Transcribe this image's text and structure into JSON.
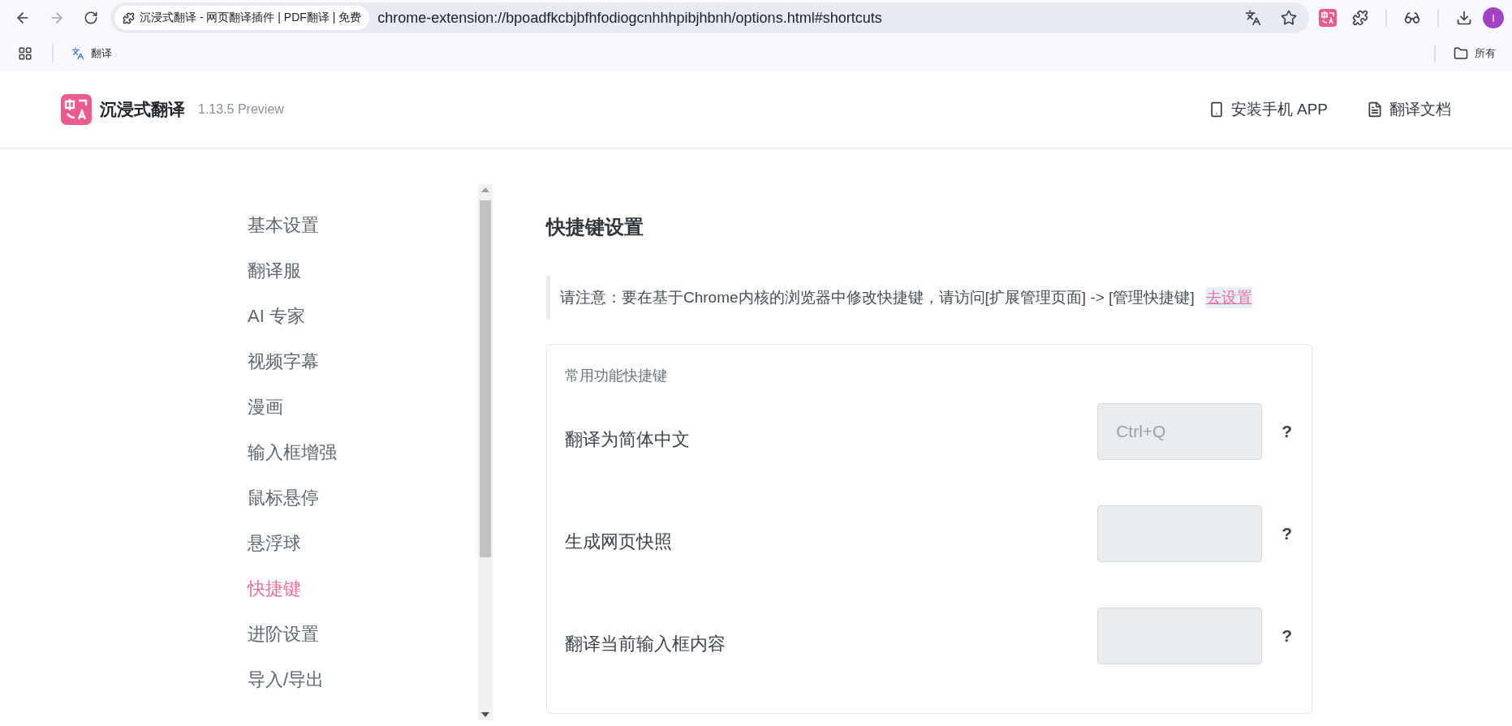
{
  "browser": {
    "tab_title": "沉浸式翻译 - 网页翻译插件 | PDF翻译 | 免费",
    "url": "chrome-extension://bpoadfkcbjbfhfodiogcnhhhpibjhbnh/options.html#shortcuts",
    "forward_disabled": true,
    "bookmarks": [
      {
        "label": "翻译"
      }
    ],
    "other_bookmarks": "所有",
    "profile_initial": "I"
  },
  "header": {
    "app_name": "沉浸式翻译",
    "version": "1.13.5 Preview",
    "links": [
      {
        "label": "安装手机 APP",
        "kind": "phone"
      },
      {
        "label": "翻译文档",
        "kind": "doc"
      }
    ]
  },
  "sidebar": {
    "items": [
      {
        "label": "基本设置",
        "selected": false
      },
      {
        "label": "翻译服",
        "selected": false
      },
      {
        "label": "AI 专家",
        "selected": false
      },
      {
        "label": "视频字幕",
        "selected": false
      },
      {
        "label": "漫画",
        "selected": false
      },
      {
        "label": "输入框增强",
        "selected": false
      },
      {
        "label": "鼠标悬停",
        "selected": false
      },
      {
        "label": "悬浮球",
        "selected": false
      },
      {
        "label": "快捷键",
        "selected": true
      },
      {
        "label": "进阶设置",
        "selected": false
      },
      {
        "label": "导入/导出",
        "selected": false
      }
    ]
  },
  "page": {
    "title": "快捷键设置",
    "notice": "请注意：要在基于Chrome内核的浏览器中修改快捷键，请访问[扩展管理页面] -> [管理快捷键]",
    "notice_link": "去设置",
    "section": {
      "title": "常用功能快捷键",
      "shortcuts": [
        {
          "label": "翻译为简体中文",
          "placeholder": "Ctrl+Q",
          "help": "?"
        },
        {
          "label": "生成网页快照",
          "help": "?"
        },
        {
          "label": "翻译当前输入框内容",
          "help": "?"
        }
      ]
    }
  }
}
